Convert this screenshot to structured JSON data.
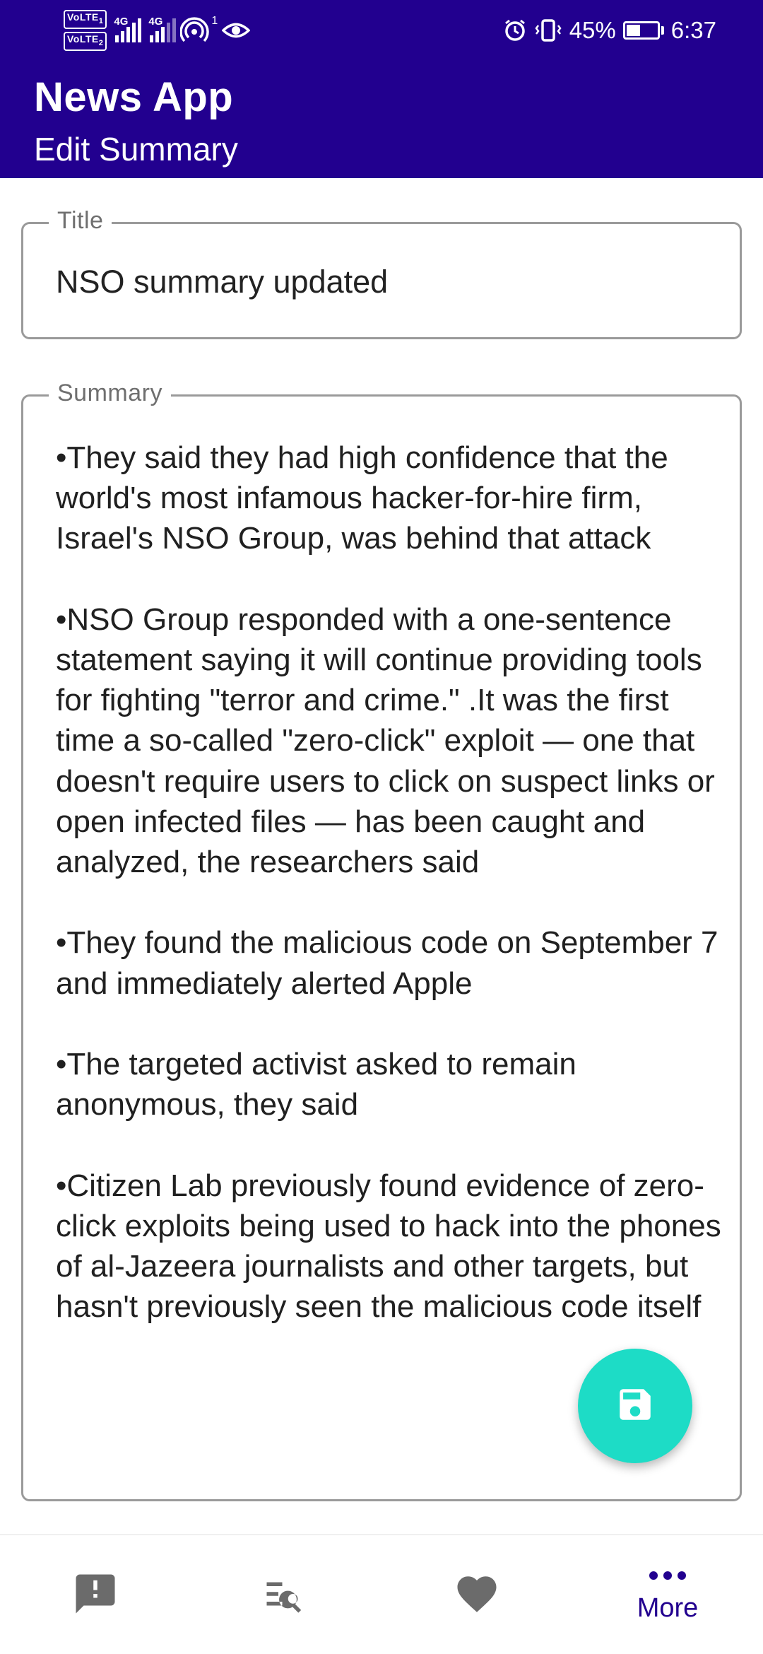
{
  "status_bar": {
    "volte_1": "VoLTE",
    "volte_1_sim": "1",
    "volte_2": "VoLTE",
    "volte_2_sim": "2",
    "signal_1_label": "4G",
    "signal_2_label": "4G",
    "hotspot_count": "1",
    "battery_percent": "45%",
    "battery_level": 0.45,
    "time": "6:37"
  },
  "app_bar": {
    "title": "News App",
    "subtitle": "Edit Summary"
  },
  "title_field": {
    "label": "Title",
    "value": "NSO summary updated"
  },
  "summary_field": {
    "label": "Summary",
    "value": "•They said they had high confidence that the world's most infamous hacker-for-hire firm, Israel's NSO Group, was behind that attack\n\n•NSO Group responded with a one-sentence statement saying it will continue providing tools for fighting \"terror and crime.\" .It was the first time a so-called \"zero-click\" exploit — one that doesn't require users to click on suspect links or open infected files — has been caught and analyzed, the researchers said\n\n•They found the malicious code on September 7 and immediately alerted Apple\n\n•The targeted activist asked to remain anonymous, they said\n\n•Citizen Lab previously found evidence of zero-click exploits being used to hack into the phones of al-Jazeera journalists and other targets, but hasn't previously seen the malicious code itself"
  },
  "fab": {
    "icon": "save-icon",
    "color": "#1ddcc6"
  },
  "bottom_nav": {
    "items": [
      {
        "icon": "alert-icon",
        "label": ""
      },
      {
        "icon": "search-list-icon",
        "label": ""
      },
      {
        "icon": "heart-icon",
        "label": ""
      },
      {
        "icon": "more-icon",
        "label": "More"
      }
    ]
  },
  "colors": {
    "app_bar": "#22008f",
    "accent": "#1ddcc6",
    "nav_icon": "#6b6b6b",
    "nav_active": "#22008f"
  }
}
